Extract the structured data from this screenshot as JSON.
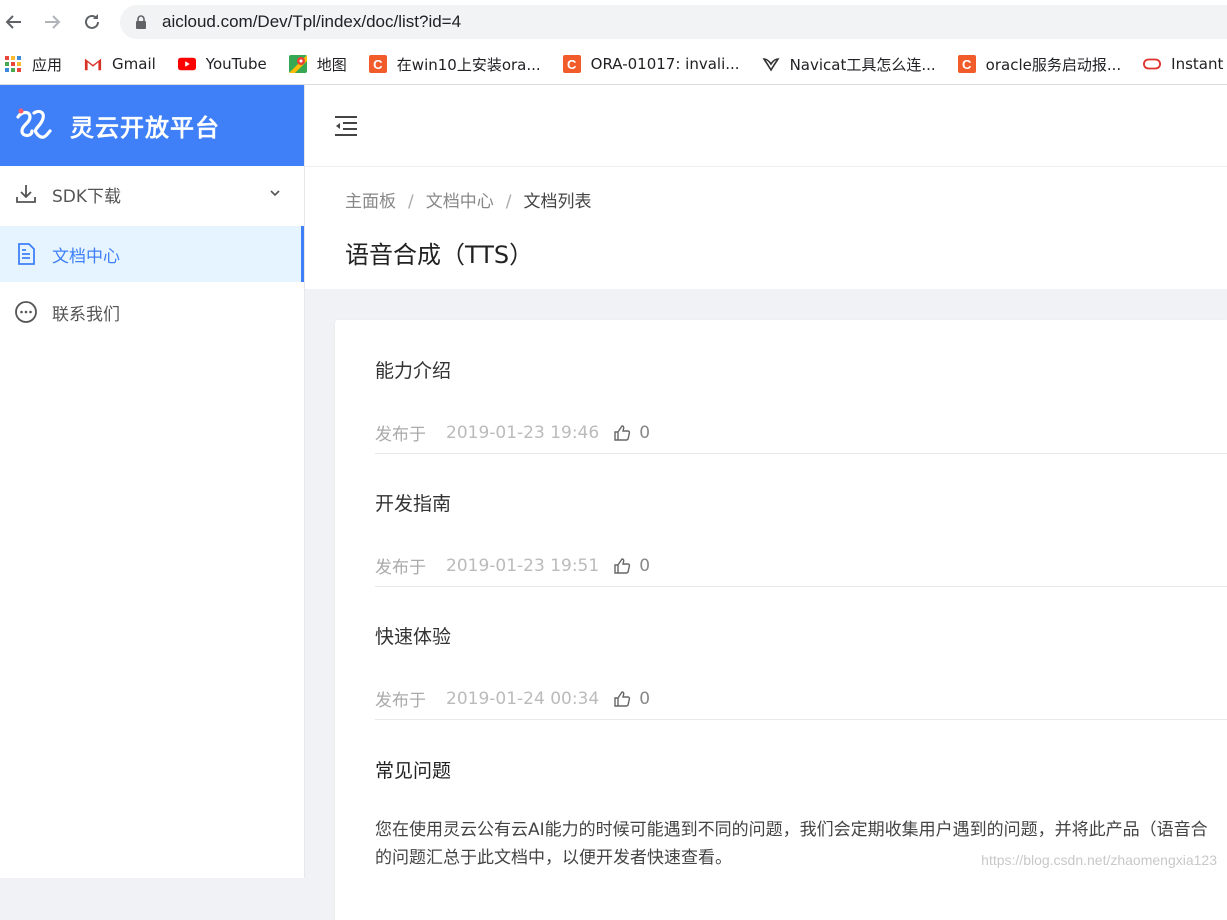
{
  "browser": {
    "url": "aicloud.com/Dev/Tpl/index/doc/list?id=4",
    "bookmarks": [
      {
        "label": "应用",
        "icon": "apps-grid-icon"
      },
      {
        "label": "Gmail",
        "icon": "gmail-icon"
      },
      {
        "label": "YouTube",
        "icon": "youtube-icon"
      },
      {
        "label": "地图",
        "icon": "maps-icon"
      },
      {
        "label": "在win10上安装ora...",
        "icon": "csdn-icon"
      },
      {
        "label": "ORA-01017: invali...",
        "icon": "csdn-icon"
      },
      {
        "label": "Navicat工具怎么连...",
        "icon": "navicat-icon"
      },
      {
        "label": "oracle服务启动报...",
        "icon": "csdn-icon"
      },
      {
        "label": "Instant Clie",
        "icon": "oracle-icon"
      }
    ]
  },
  "brand": {
    "name": "灵云开放平台"
  },
  "sidebar": {
    "items": [
      {
        "label": "SDK下载"
      },
      {
        "label": "文档中心"
      },
      {
        "label": "联系我们"
      }
    ]
  },
  "breadcrumb": [
    "主面板",
    "文档中心",
    "文档列表"
  ],
  "page": {
    "title": "语音合成（TTS）"
  },
  "docs": [
    {
      "title": "能力介绍",
      "published_label": "发布于",
      "time": "2019-01-23 19:46",
      "likes": "0"
    },
    {
      "title": "开发指南",
      "published_label": "发布于",
      "time": "2019-01-23 19:51",
      "likes": "0"
    },
    {
      "title": "快速体验",
      "published_label": "发布于",
      "time": "2019-01-24 00:34",
      "likes": "0"
    }
  ],
  "faq": {
    "title": "常见问题",
    "description_line1": "您在使用灵云公有云AI能力的时候可能遇到不同的问题，我们会定期收集用户遇到的问题，并将此产品（语音合",
    "description_line2": "的问题汇总于此文档中，以便开发者快速查看。"
  },
  "watermark": "https://blog.csdn.net/zhaomengxia123",
  "colors": {
    "accent": "#3f80f8",
    "active_bg": "#e6f4ff"
  }
}
